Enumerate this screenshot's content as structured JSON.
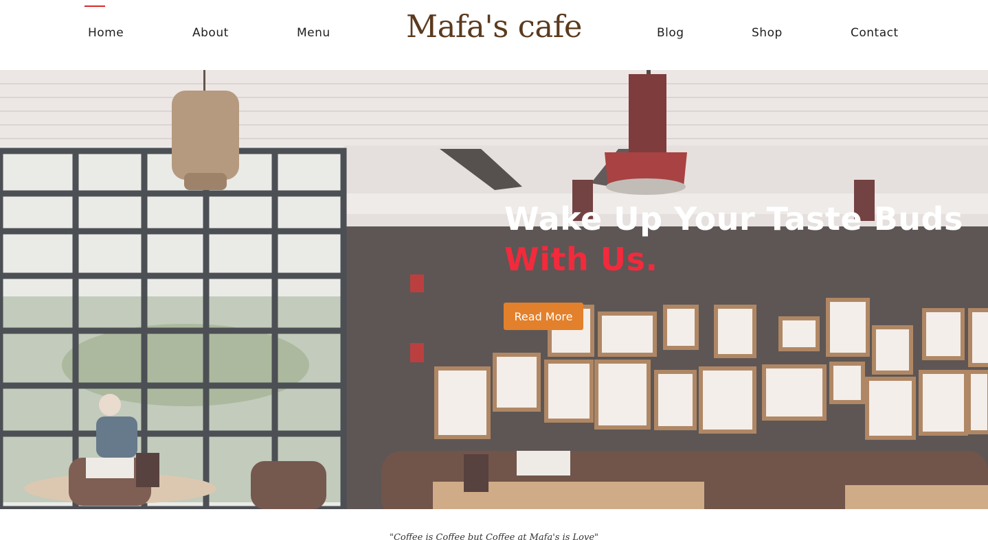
{
  "nav": {
    "left": [
      {
        "label": "Home",
        "active": true
      },
      {
        "label": "About"
      },
      {
        "label": "Menu"
      }
    ],
    "right": [
      {
        "label": "Blog"
      },
      {
        "label": "Shop"
      },
      {
        "label": "Contact"
      }
    ],
    "active_color": "#d62828"
  },
  "logo": {
    "text": "Mafa's cafe",
    "color": "#5b3a1e"
  },
  "hero": {
    "title_line1": "Wake Up Your Taste Buds",
    "title_line2": "With Us.",
    "accent_color": "#f22a3c",
    "cta_label": "Read More",
    "cta_color": "#e3802c"
  },
  "quote": {
    "text": "\"Coffee is Coffee but Coffee at Mafa's is Love\""
  }
}
